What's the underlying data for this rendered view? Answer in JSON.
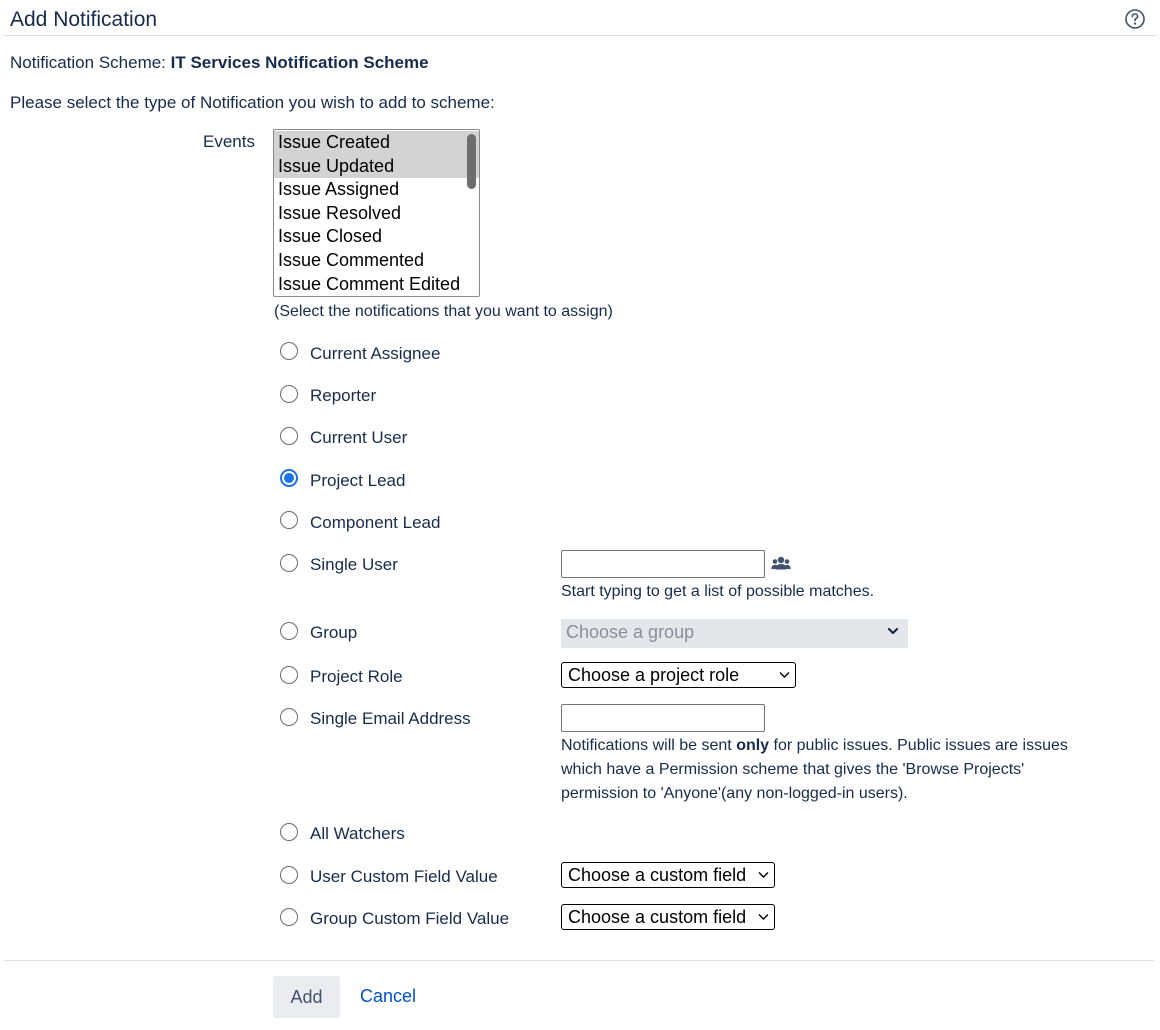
{
  "header": {
    "title": "Add Notification",
    "help_icon": "help-circle-icon"
  },
  "scheme": {
    "label": "Notification Scheme: ",
    "name": "IT Services Notification Scheme"
  },
  "intro": "Please select the type of Notification you wish to add to scheme:",
  "events": {
    "label": "Events",
    "items": [
      {
        "label": "Issue Created",
        "selected": true
      },
      {
        "label": "Issue Updated",
        "selected": true
      },
      {
        "label": "Issue Assigned",
        "selected": false
      },
      {
        "label": "Issue Resolved",
        "selected": false
      },
      {
        "label": "Issue Closed",
        "selected": false
      },
      {
        "label": "Issue Commented",
        "selected": false
      },
      {
        "label": "Issue Comment Edited",
        "selected": false
      }
    ],
    "hint": "(Select the notifications that you want to assign)"
  },
  "options": [
    {
      "label": "Current Assignee",
      "checked": false
    },
    {
      "label": "Reporter",
      "checked": false
    },
    {
      "label": "Current User",
      "checked": false
    },
    {
      "label": "Project Lead",
      "checked": true
    },
    {
      "label": "Component Lead",
      "checked": false
    },
    {
      "label": "Single User",
      "checked": false
    },
    {
      "label": "Group",
      "checked": false
    },
    {
      "label": "Project Role",
      "checked": false
    },
    {
      "label": "Single Email Address",
      "checked": false
    },
    {
      "label": "All Watchers",
      "checked": false
    },
    {
      "label": "User Custom Field Value",
      "checked": false
    },
    {
      "label": "Group Custom Field Value",
      "checked": false
    }
  ],
  "single_user": {
    "value": "",
    "picker_icon": "users-icon",
    "hint": "Start typing to get a list of possible matches."
  },
  "group": {
    "placeholder": "Choose a group"
  },
  "project_role": {
    "selected": "Choose a project role"
  },
  "email": {
    "value": "",
    "note_before": "Notifications will be sent ",
    "note_bold": "only",
    "note_line1_rest": " for public issues. Public issues are issues",
    "note_line2": "which have a Permission scheme that gives the 'Browse Projects'",
    "note_line3": "permission to 'Anyone'(any non-logged-in users)."
  },
  "user_custom_field": {
    "selected": "Choose a custom field"
  },
  "group_custom_field": {
    "selected": "Choose a custom field"
  },
  "actions": {
    "add_label": "Add",
    "cancel_label": "Cancel"
  },
  "colors": {
    "text": "#172b4d",
    "link": "#0052cc",
    "radio_checked": "#1a73e8",
    "selected_event_bg": "#d3d3d3"
  }
}
